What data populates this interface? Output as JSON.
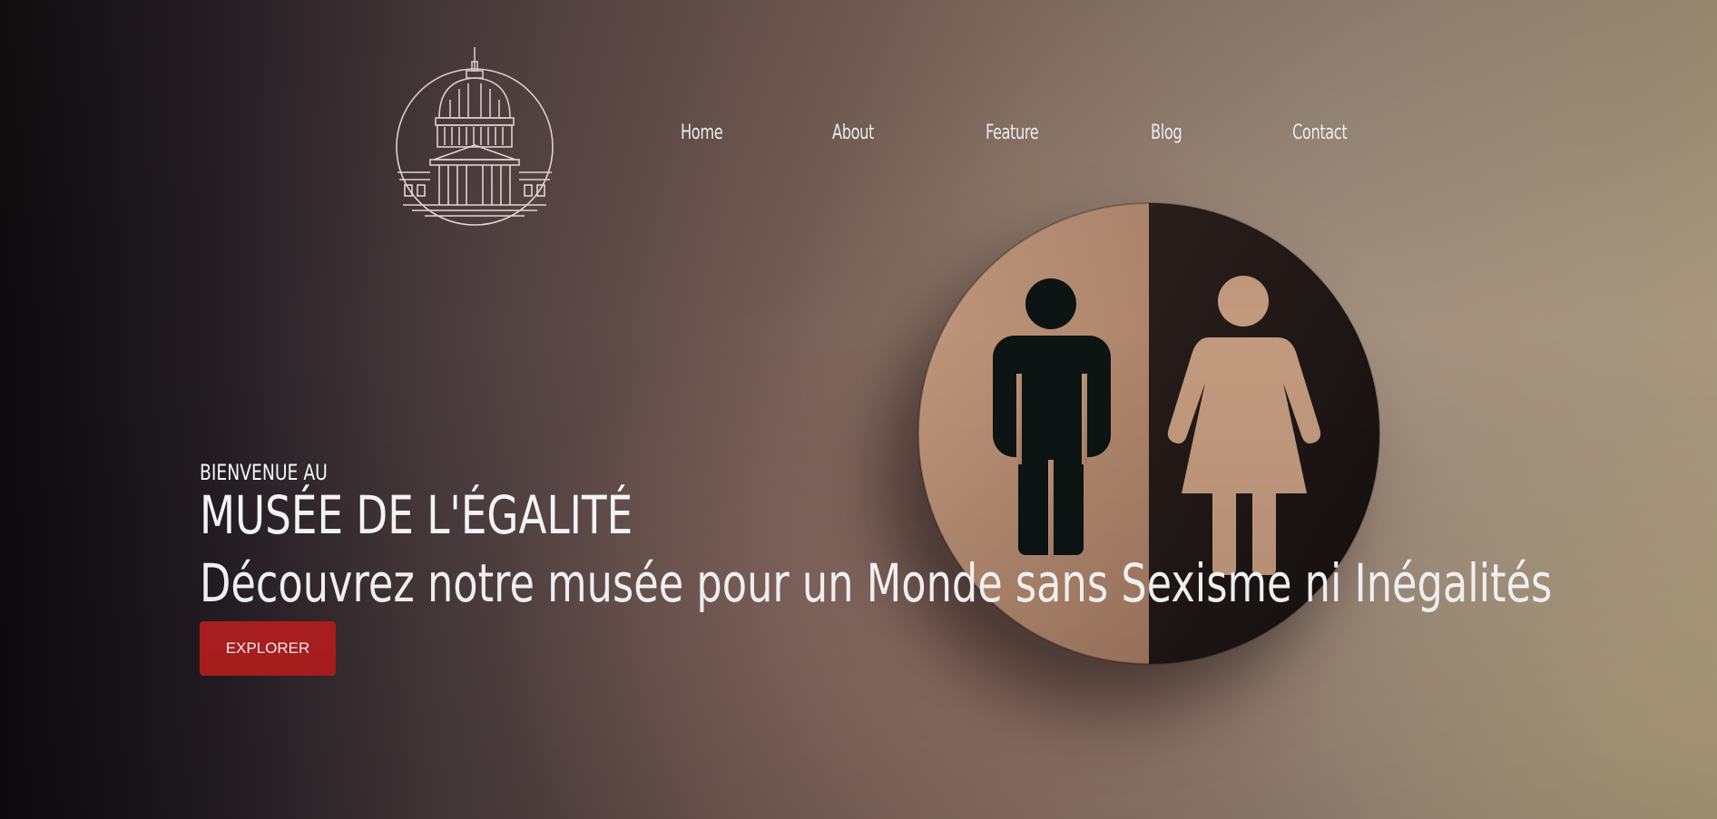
{
  "nav": {
    "items": [
      {
        "label": "Home"
      },
      {
        "label": "About"
      },
      {
        "label": "Feature"
      },
      {
        "label": "Blog"
      },
      {
        "label": "Contact"
      }
    ]
  },
  "logo": {
    "icon": "capitol-dome-icon"
  },
  "hero": {
    "kicker": "BIENVENUE AU",
    "title": "MUSÉE DE L'ÉGALITÉ",
    "tagline": "Découvrez notre musée pour un Monde sans Sexisme ni Inégalités",
    "cta_label": "EXPLORER"
  },
  "colors": {
    "accent": "#b61f1f",
    "text": "#ffffff",
    "logo_stroke": "#f2dede"
  },
  "background": {
    "image": "restroom-sign-man-woman"
  }
}
